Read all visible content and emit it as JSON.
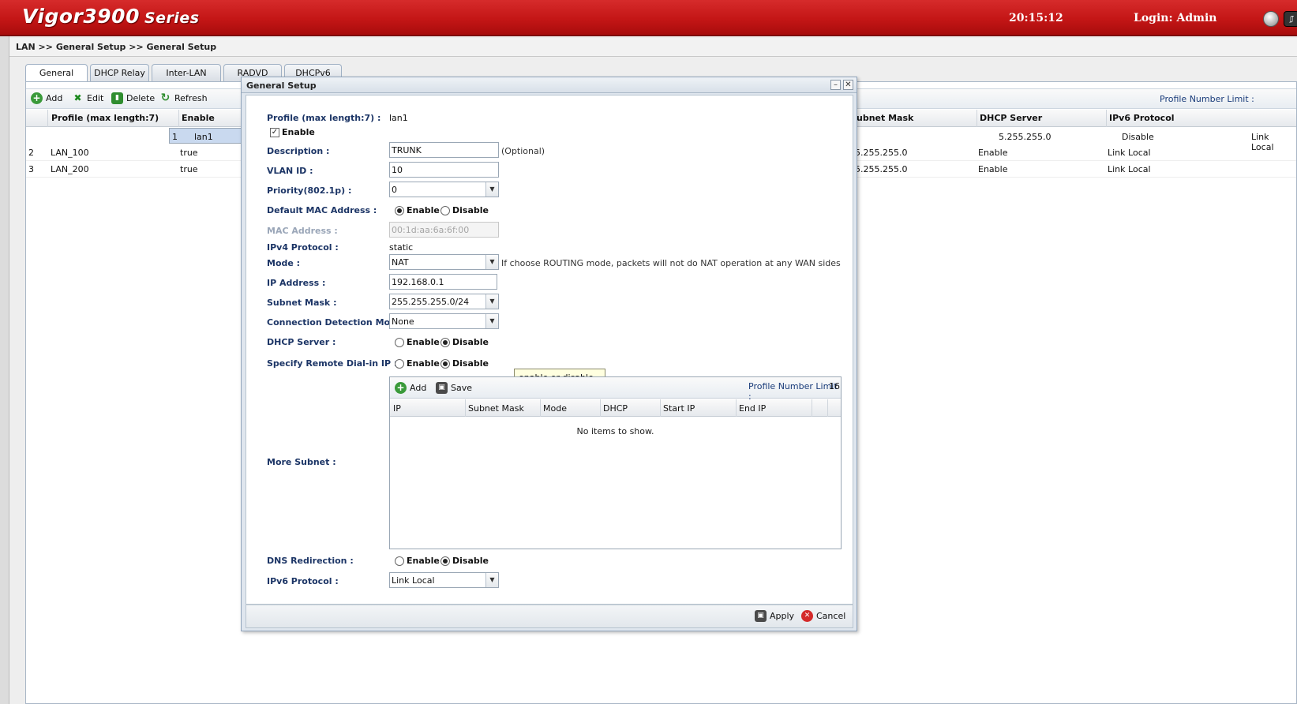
{
  "header": {
    "logo": "Vigor3900",
    "logo_series": "Series",
    "time": "20:15:12",
    "login": "Login: Admin"
  },
  "breadcrumb": "LAN >> General Setup >> General Setup",
  "tabs": [
    "General Setup",
    "DHCP Relay",
    "Inter-LAN Route",
    "RADVD",
    "DHCPv6"
  ],
  "toolbar": {
    "add": "Add",
    "edit": "Edit",
    "delete": "Delete",
    "refresh": "Refresh",
    "profile_limit": "Profile Number Limit :"
  },
  "grid": {
    "headers_left": [
      "Profile (max length:7)",
      "Enable"
    ],
    "headers_right": [
      "ubnet Mask",
      "DHCP Server",
      "IPv6 Protocol"
    ],
    "rows": [
      {
        "num": "1",
        "profile": "lan1",
        "enable": "true",
        "mask": "5.255.255.0",
        "dhcp": "Disable",
        "ipv6": "Link Local"
      },
      {
        "num": "2",
        "profile": "LAN_100",
        "enable": "true",
        "mask": "5.255.255.0",
        "dhcp": "Enable",
        "ipv6": "Link Local"
      },
      {
        "num": "3",
        "profile": "LAN_200",
        "enable": "true",
        "mask": "5.255.255.0",
        "dhcp": "Enable",
        "ipv6": "Link Local"
      }
    ]
  },
  "dialog": {
    "title": "General Setup",
    "profile_label": "Profile (max length:7) :",
    "profile_value": "lan1",
    "enable_label": "Enable",
    "description_label": "Description :",
    "description_value": "TRUNK",
    "optional": "(Optional)",
    "vlan_label": "VLAN ID :",
    "vlan_value": "10",
    "priority_label": "Priority(802.1p) :",
    "priority_value": "0",
    "default_mac_label": "Default MAC Address :",
    "mac_label": "MAC Address :",
    "mac_value": "00:1d:aa:6a:6f:00",
    "ipv4_label": "IPv4 Protocol :",
    "ipv4_value": "static",
    "mode_label": "Mode :",
    "mode_value": "NAT",
    "mode_hint": "If choose ROUTING mode, packets will not do NAT operation at any WAN sides",
    "ip_label": "IP Address :",
    "ip_value": "192.168.0.1",
    "subnet_label": "Subnet Mask :",
    "subnet_value": "255.255.255.0/24",
    "conn_label": "Connection Detection Mode :",
    "conn_value": "None",
    "dhcp_label": "DHCP Server :",
    "remote_label": "Specify Remote Dial-in IP :",
    "tooltip": "enable or disable state",
    "more_subnet_label": "More Subnet :",
    "sub_add": "Add",
    "sub_save": "Save",
    "sub_limit_label": "Profile Number Limit :",
    "sub_limit_value": "16",
    "sub_headers": [
      "IP",
      "Subnet Mask",
      "Mode",
      "DHCP",
      "Start IP",
      "End IP"
    ],
    "sub_empty": "No items to show.",
    "dns_label": "DNS Redirection :",
    "ipv6_label": "IPv6 Protocol :",
    "ipv6_value": "Link Local",
    "opt_enable": "Enable",
    "opt_disable": "Disable",
    "apply": "Apply",
    "cancel": "Cancel"
  }
}
